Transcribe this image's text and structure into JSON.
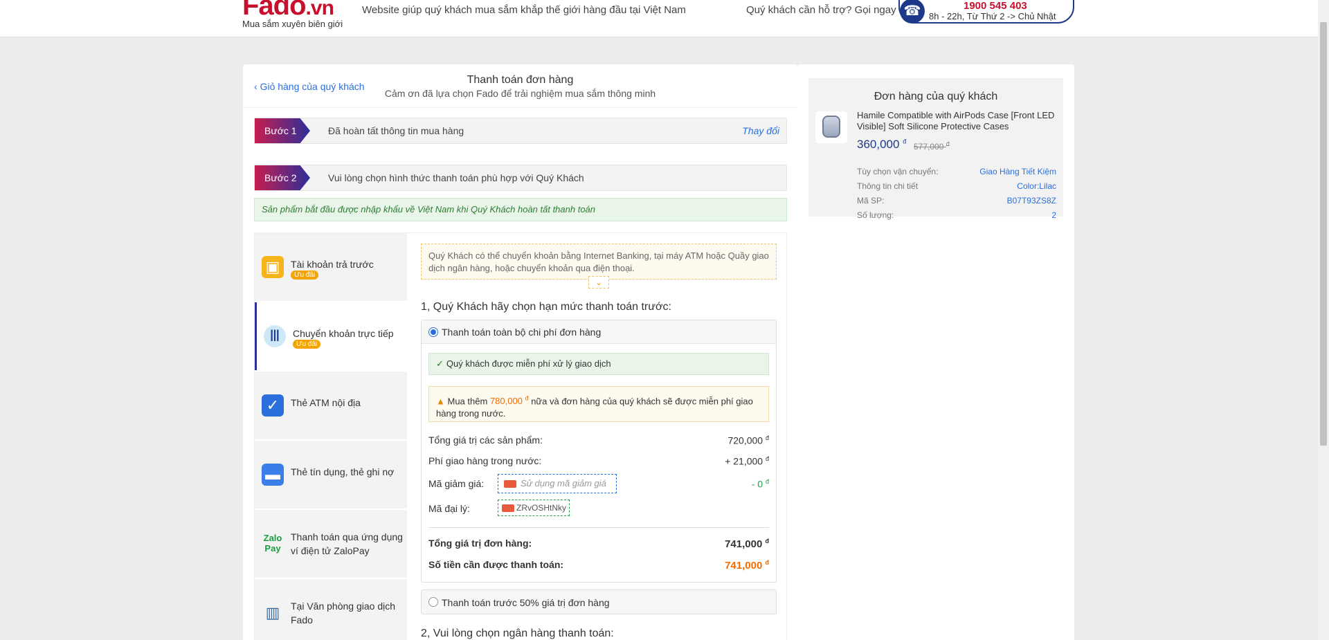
{
  "header": {
    "logo_text": "Fado",
    "logo_domain": ".vn",
    "logo_sub": "Mua sắm xuyên biên giới",
    "tagline": "Website giúp quý khách mua sắm khắp thế giới hàng đầu tại Việt Nam",
    "help_text": "Quý khách cần hỗ trợ? Gọi ngay",
    "hotline": "1900 545 403",
    "hours": "8h - 22h, Từ Thứ 2 -> Chủ Nhật"
  },
  "main": {
    "back_link": "Giỏ hàng của quý khách",
    "title": "Thanh toán đơn hàng",
    "subtitle": "Cảm ơn đã lựa chọn Fado để trải nghiệm mua sắm thông minh",
    "step1": {
      "tag": "Bước 1",
      "text": "Đã hoàn tất thông tin mua hàng",
      "change": "Thay đổi"
    },
    "step2": {
      "tag": "Bước 2",
      "text": "Vui lòng chọn hình thức thanh toán phù hợp với Quý Khách"
    },
    "notice": "Sản phẩm bắt đầu được nhập khẩu về Việt Nam khi Quý Khách hoàn tất thanh toán"
  },
  "methods": [
    {
      "label": "Tài khoản trả trước",
      "badge": "Ưu đãi",
      "icon": "wallet-icon"
    },
    {
      "label": "Chuyển khoản trực tiếp",
      "badge": "Ưu đãi",
      "icon": "bank-icon"
    },
    {
      "label": "Thẻ ATM nội địa",
      "badge": "",
      "icon": "atm-card-icon"
    },
    {
      "label": "Thẻ tín dụng, thẻ ghi nợ",
      "badge": "",
      "icon": "credit-card-icon"
    },
    {
      "label": "Thanh toán qua ứng dụng ví điện tử ZaloPay",
      "badge": "",
      "icon": "zalopay-icon"
    },
    {
      "label": "Tại Văn phòng giao dịch Fado",
      "badge": "",
      "icon": "office-building-icon"
    }
  ],
  "content": {
    "info": "Quý Khách có thể chuyển khoản bằng Internet Banking, tại máy ATM hoặc Quầy giao dịch ngân hàng, hoặc chuyển khoản qua điện thoại.",
    "limit_heading": "1, Quý Khách hãy chọn hạn mức thanh toán trước:",
    "option_full": "Thanh toán toàn bộ chi phí đơn hàng",
    "free_fee": "Quý khách được miễn phí xử lý giao dịch",
    "warn_pre": "Mua thêm",
    "warn_amount": "780,000",
    "warn_post": "nữa và đơn hàng của quý khách sẽ được miễn phí giao hàng trong nước.",
    "currency": "đ",
    "products_label": "Tổng giá trị các sản phẩm:",
    "products_value": "720,000",
    "shipping_label": "Phí giao hàng trong nước:",
    "shipping_value": "+ 21,000",
    "discount_label": "Mã giảm giá:",
    "discount_placeholder": "Sử dụng mã giảm giá",
    "discount_value": "- 0",
    "agent_label": "Mã đại lý:",
    "agent_code": "ZRvOSHtNky",
    "total_label": "Tổng giá trị đơn hàng:",
    "total_value": "741,000",
    "pay_label": "Số tiền cần được thanh toán:",
    "pay_value": "741,000",
    "option_half": "Thanh toán trước 50% giá trị đơn hàng",
    "bank_heading": "2, Vui lòng chọn ngân hàng thanh toán:"
  },
  "order": {
    "title": "Đơn hàng của quý khách",
    "product_name": "Hamile Compatible with AirPods Case [Front LED Visible] Soft Silicone Protective Cases",
    "price": "360,000",
    "old_price": "577,000",
    "shipping_label": "Tùy chọn vận chuyển:",
    "shipping_value": "Giao Hàng Tiết Kiệm",
    "detail_label": "Thông tin chi tiết",
    "detail_value": "Color:Lilac",
    "sku_label": "Mã SP:",
    "sku_value": "B07T93ZS8Z",
    "qty_label": "Số lượng:",
    "qty_value": "2"
  },
  "colors": {
    "brand": "#c8102e",
    "accent": "#2a6fdb",
    "navy": "#1d3a8a",
    "orange": "#f26c00"
  }
}
